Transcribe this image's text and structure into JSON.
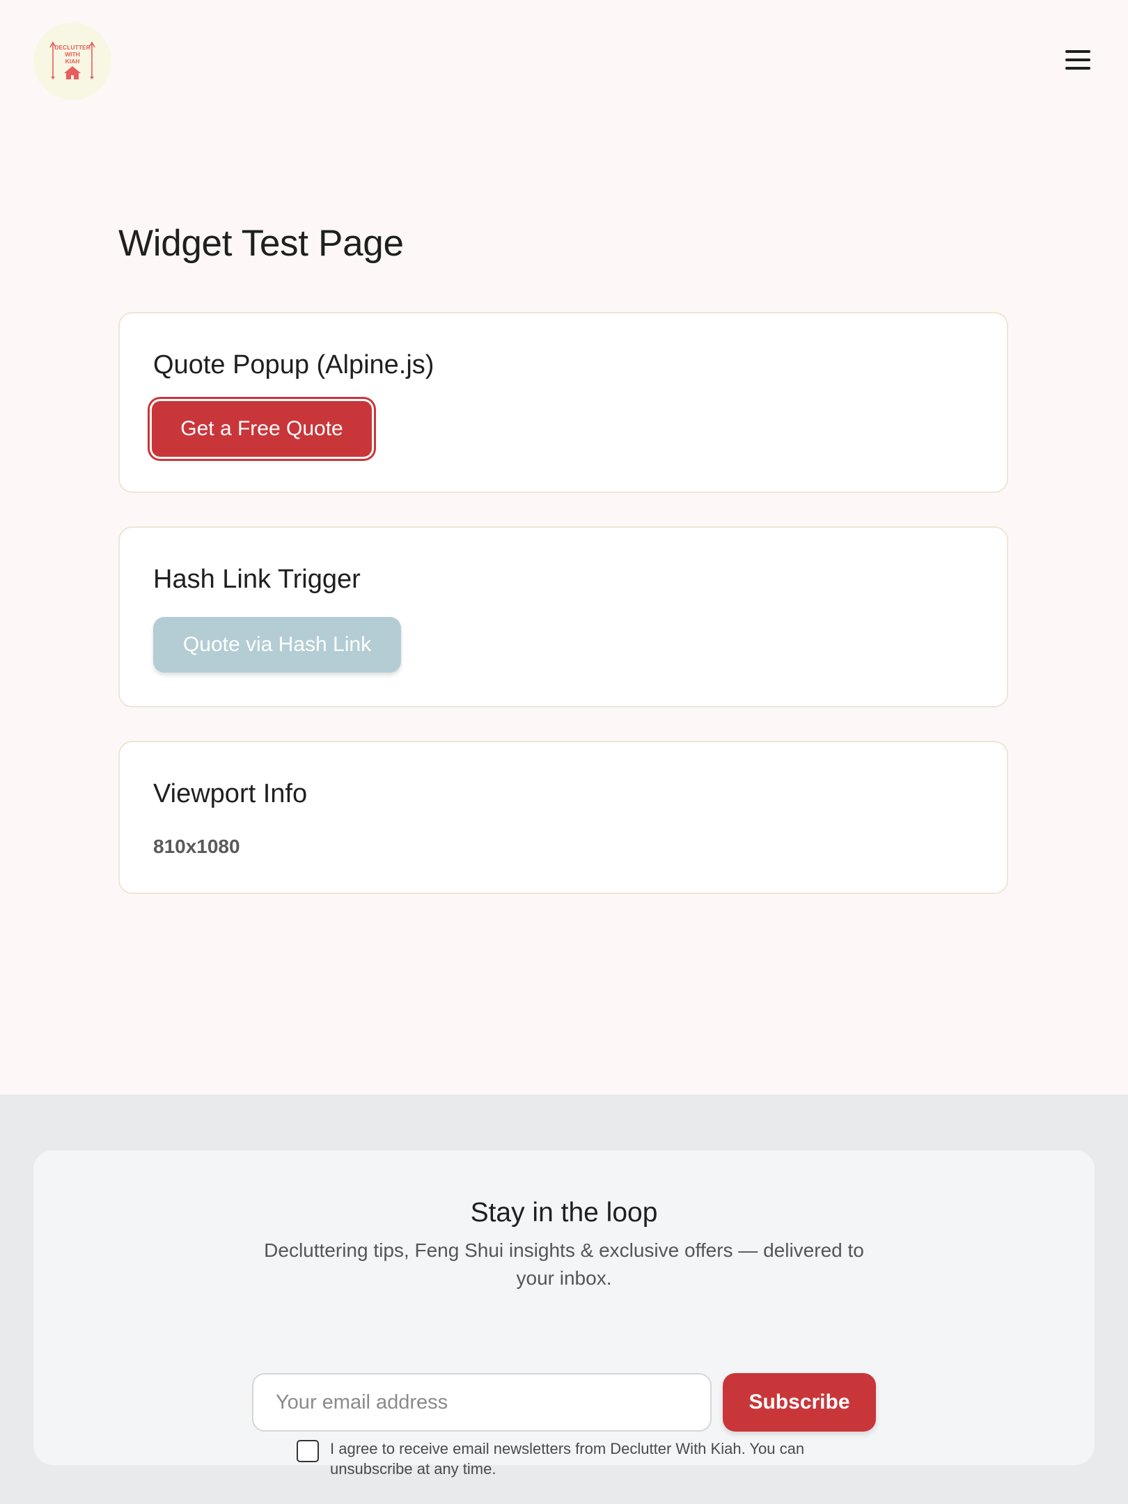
{
  "header": {
    "logo": {
      "text_lines": [
        "DECLUTTER",
        "WITH",
        "KIAH"
      ],
      "icon": "house-icon",
      "color": "#e85d5d"
    },
    "menu_icon": "hamburger-menu-icon"
  },
  "main": {
    "title": "Widget Test Page",
    "cards": [
      {
        "title": "Quote Popup (Alpine.js)",
        "button_label": "Get a Free Quote"
      },
      {
        "title": "Hash Link Trigger",
        "button_label": "Quote via Hash Link"
      },
      {
        "title": "Viewport Info",
        "value": "810x1080"
      }
    ]
  },
  "newsletter": {
    "title": "Stay in the loop",
    "description": "Decluttering tips, Feng Shui insights & exclusive offers — delivered to your inbox.",
    "email_placeholder": "Your email address",
    "email_value": "",
    "subscribe_label": "Subscribe",
    "consent_text": "I agree to receive email newsletters from Declutter With Kiah. You can unsubscribe at any time.",
    "consent_checked": false
  },
  "colors": {
    "page_background": "#fdf8f7",
    "accent_red": "#c9363a",
    "secondary_button": "#b4cdd4",
    "footer_background": "#e8eaec"
  }
}
